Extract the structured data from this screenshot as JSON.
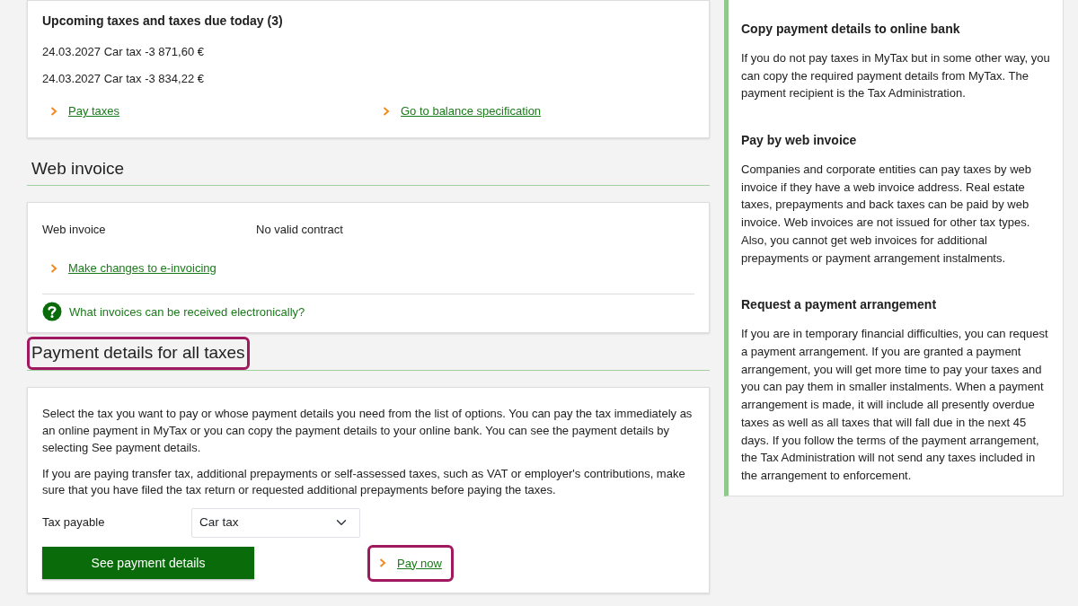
{
  "upcoming": {
    "heading": "Upcoming taxes and taxes due today (3)",
    "items": [
      "24.03.2027 Car tax -3 871,60 €",
      "24.03.2027 Car tax -3 834,22 €"
    ],
    "links": [
      {
        "label": "Pay taxes",
        "highlighted": false
      },
      {
        "label": "Go to balance specification",
        "highlighted": false
      }
    ]
  },
  "web_invoice": {
    "heading": "Web invoice",
    "highlighted": false,
    "label": "Web invoice",
    "value": "No valid contract",
    "link": {
      "label": "Make changes to e-invoicing",
      "highlighted": false
    },
    "help": "What invoices can be received electronically?"
  },
  "payment_details": {
    "heading": "Payment details for all taxes",
    "highlighted": true,
    "paragraphs": [
      "Select the tax you want to pay or whose payment details you need from the list of options. You can pay the tax immediately as an online payment in MyTax or you can copy the payment details to your online bank. You can see the payment details by selecting See payment details.",
      "If you are paying transfer tax, additional prepayments or self-assessed taxes, such as VAT or employer's contributions, make sure that you have filed the tax return or requested additional prepayments before paying the taxes."
    ],
    "field_label": "Tax payable",
    "field_value": "Car tax",
    "button": "See payment details",
    "link": {
      "label": "Pay now",
      "highlighted": true
    }
  },
  "sidebar": {
    "sections": [
      {
        "heading": "Copy payment details to online bank",
        "text": "If you do not pay taxes in MyTax but in some other way, you can copy the required payment details from MyTax. The payment recipient is the Tax Administration."
      },
      {
        "heading": "Pay by web invoice",
        "text": "Companies and corporate entities can pay taxes by web invoice if they have a web invoice address. Real estate taxes, prepayments and back taxes can be paid by web invoice. Web invoices are not issued for other tax types. Also, you cannot get web invoices for additional prepayments or payment arrangement instalments."
      },
      {
        "heading": "Request a payment arrangement",
        "text": "If you are in temporary financial difficulties, you can request a payment arrangement. If you are granted a payment arrangement, you will get more time to pay your taxes and you can pay them in smaller instalments. When a payment arrangement is made, it will include all presently overdue taxes as well as all taxes that will fall due in the next 45 days. If you follow the terms of the payment arrangement, the Tax Administration will not send any taxes included in the arrangement to enforcement."
      }
    ]
  }
}
